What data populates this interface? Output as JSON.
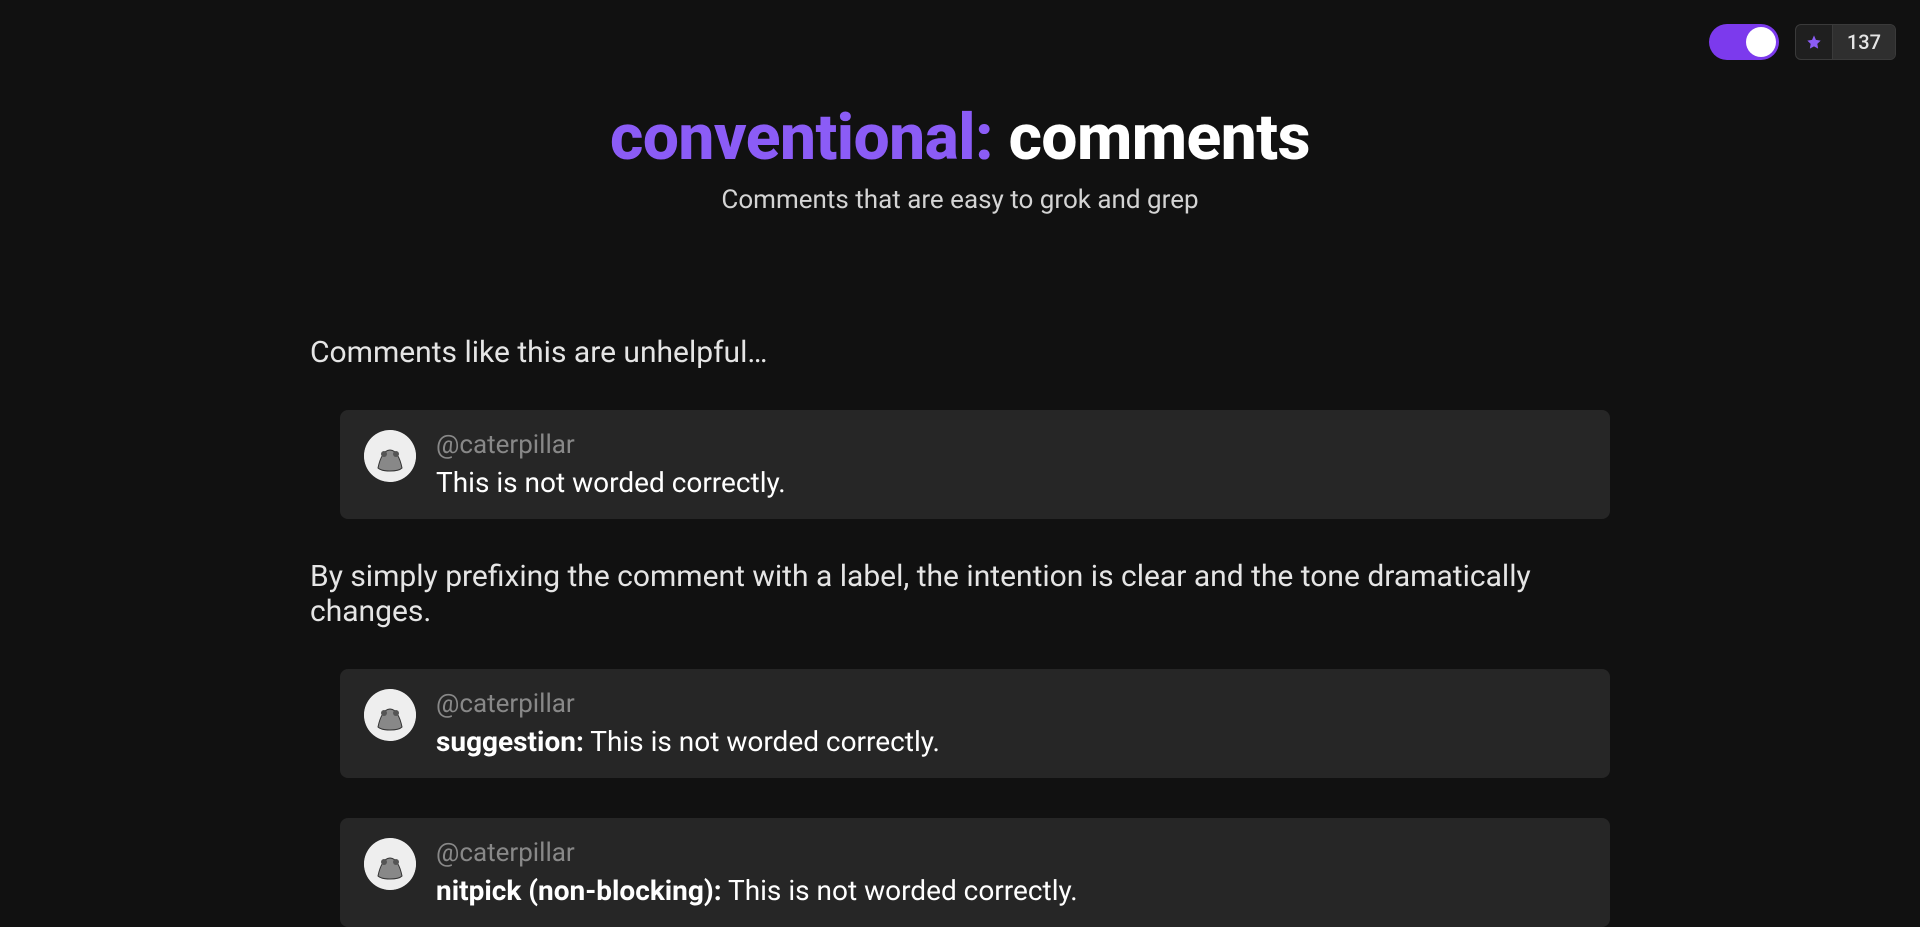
{
  "header": {
    "star_count": "137"
  },
  "hero": {
    "title_prefix": "conventional:",
    "title_suffix": " comments",
    "subtitle": "Comments that are easy to grok and grep"
  },
  "content": {
    "intro1": "Comments like this are unhelpful…",
    "intro2": "By simply prefixing the comment with a label, the intention is clear and the tone dramatically changes.",
    "comments": [
      {
        "user": "@caterpillar",
        "label": "",
        "text": "This is not worded correctly."
      },
      {
        "user": "@caterpillar",
        "label": "suggestion:",
        "text": " This is not worded correctly."
      },
      {
        "user": "@caterpillar",
        "label": "nitpick (non-blocking):",
        "text": " This is not worded correctly."
      }
    ]
  }
}
